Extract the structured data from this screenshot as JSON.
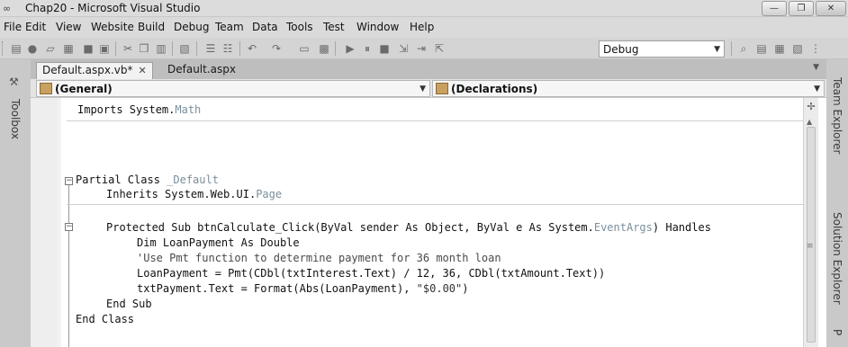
{
  "window": {
    "title": "Chap20 - Microsoft Visual Studio",
    "app_icon": "visual-studio-infinity-icon",
    "buttons": {
      "minimize": "—",
      "maximize": "❐",
      "close": "✕"
    }
  },
  "menu": [
    {
      "label": "File"
    },
    {
      "label": "Edit"
    },
    {
      "label": "View"
    },
    {
      "label": "Website"
    },
    {
      "label": "Build"
    },
    {
      "label": "Debug"
    },
    {
      "label": "Team"
    },
    {
      "label": "Data"
    },
    {
      "label": "Tools"
    },
    {
      "label": "Test"
    },
    {
      "label": "Window"
    },
    {
      "label": "Help"
    }
  ],
  "toolbar": {
    "config_value": "Debug",
    "icons": [
      "new-project-icon",
      "new-item-icon",
      "open-file-icon",
      "add-item-icon",
      "save-icon",
      "save-all-icon",
      "cut-icon",
      "copy-icon",
      "paste-icon",
      "navigate-icon",
      "comment-icon",
      "uncomment-icon",
      "undo-icon",
      "redo-icon",
      "find-icon",
      "navigate-backward-icon",
      "start-debug-icon",
      "pause-icon",
      "stop-icon",
      "step-into-icon",
      "step-over-icon",
      "step-out-icon",
      "find-in-files-icon",
      "solution-explorer-icon",
      "properties-icon",
      "object-browser-icon",
      "toolbox-icon"
    ]
  },
  "left_panel": {
    "label": "Toolbox"
  },
  "right_panel": {
    "team_explorer": "Team Explorer",
    "solution_explorer": "Solution Explorer",
    "properties": "P"
  },
  "tabs": [
    {
      "label": "Default.aspx.vb*",
      "active": true,
      "close": "✕"
    },
    {
      "label": "Default.aspx",
      "active": false
    }
  ],
  "nav": {
    "left": "(General)",
    "right": "(Declarations)"
  },
  "code": {
    "l1": {
      "kw": "Imports ",
      "a": "System.",
      "t": "Math"
    },
    "l2": {
      "kw": "Partial Class ",
      "t": "_Default"
    },
    "l3": {
      "kw": "Inherits ",
      "a": "System.Web.UI.",
      "t": "Page"
    },
    "l4": {
      "a": "Protected Sub btnCalculate_Click(ByVal sender As Object, ByVal e As System.",
      "t": "EventArgs",
      "b": ") Handles"
    },
    "l5": {
      "a": "Dim LoanPayment As Double"
    },
    "l6": {
      "c": "'Use Pmt function to determine payment for 36 month loan"
    },
    "l7": {
      "a": "LoanPayment = Pmt(CDbl(txtInterest.Text) / 12, 36, CDbl(txtAmount.Text))"
    },
    "l8": {
      "a": "txtPayment.Text = Format(Abs(LoanPayment), ",
      "s": "\"$0.00\"",
      "b": ")"
    },
    "l9": {
      "a": "End Sub"
    },
    "l10": {
      "a": "End Class"
    }
  },
  "colors": {
    "type_name": "#7a8f9c",
    "editor_bg": "#ffffff",
    "chrome": "#d6d6d6"
  }
}
